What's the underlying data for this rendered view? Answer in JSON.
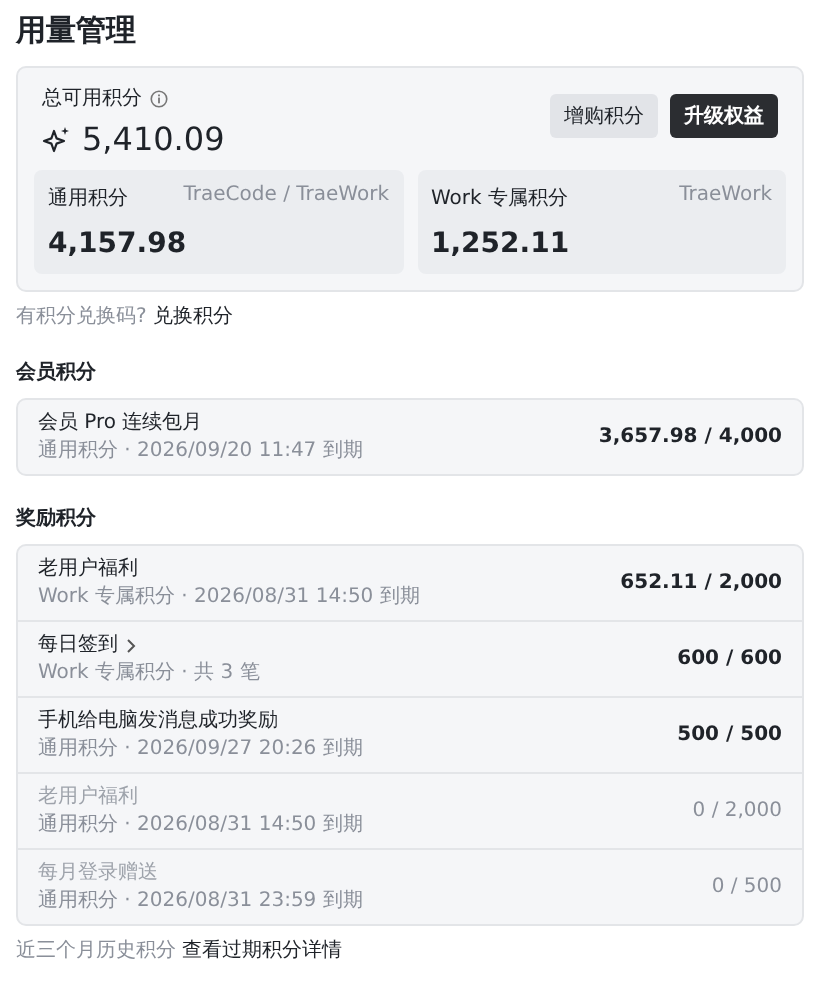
{
  "title": "用量管理",
  "total": {
    "label": "总可用积分",
    "value": "5,410.09",
    "buttons": [
      {
        "label": "增购积分",
        "kind": "secondary"
      },
      {
        "label": "升级权益",
        "kind": "primary"
      }
    ],
    "balances": [
      {
        "label": "通用积分",
        "scope": "TraeCode / TraeWork",
        "value": "4,157.98"
      },
      {
        "label": "Work 专属积分",
        "scope": "TraeWork",
        "value": "1,252.11"
      }
    ]
  },
  "redeem": {
    "prompt": "有积分兑换码?",
    "link": "兑换积分"
  },
  "sections": [
    {
      "title": "会员积分",
      "items": [
        {
          "name": "会员 Pro 连续包月",
          "detail": "通用积分 · 2026/09/20 11:47 到期",
          "amount": "3,657.98 / 4,000",
          "disabled": false,
          "has_details": false
        }
      ]
    },
    {
      "title": "奖励积分",
      "items": [
        {
          "name": "老用户福利",
          "detail": "Work 专属积分 · 2026/08/31 14:50 到期",
          "amount": "652.11 / 2,000",
          "disabled": false,
          "has_details": false
        },
        {
          "name": "每日签到",
          "detail": "Work 专属积分 · 共 3 笔",
          "amount": "600 / 600",
          "disabled": false,
          "has_details": true
        },
        {
          "name": "手机给电脑发消息成功奖励",
          "detail": "通用积分 · 2026/09/27 20:26 到期",
          "amount": "500 / 500",
          "disabled": false,
          "has_details": false
        },
        {
          "name": "老用户福利",
          "detail": "通用积分 · 2026/08/31 14:50 到期",
          "amount": "0 / 2,000",
          "disabled": true,
          "has_details": false
        },
        {
          "name": "每月登录赠送",
          "detail": "通用积分 · 2026/08/31 23:59 到期",
          "amount": "0 / 500",
          "disabled": true,
          "has_details": false
        }
      ]
    }
  ],
  "footer": {
    "prompt": "近三个月历史积分",
    "link": "查看过期积分详情"
  }
}
